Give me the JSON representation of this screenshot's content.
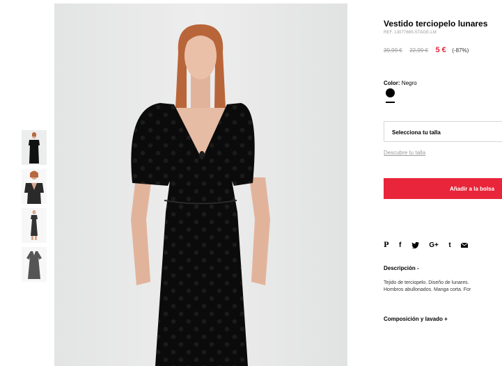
{
  "product": {
    "title": "Vestido terciopelo lunares",
    "ref": "REF. 13077665-STAGE-LM",
    "price_old_1": "39,99 €",
    "price_old_2": "22,99 €",
    "price_now": "5 €",
    "discount": "(-87%)"
  },
  "color": {
    "label": "Color:",
    "value": "Negro",
    "swatch_hex": "#000000"
  },
  "size": {
    "placeholder": "Selecciona tu talla",
    "guide_link": "Descubre tu talla"
  },
  "cart": {
    "add_label": "Añadir a la bolsa",
    "accent": "#e8253a"
  },
  "share": {
    "icons": [
      "pinterest-icon",
      "facebook-icon",
      "twitter-icon",
      "google-plus-icon",
      "tumblr-icon",
      "email-icon"
    ],
    "pinterest_glyph": "P",
    "facebook_glyph": "f",
    "googleplus_glyph": "G+",
    "tumblr_glyph": "t"
  },
  "description": {
    "heading": "Descripción -",
    "line1": "Tejido de terciopelo. Diseño de lunares.",
    "line2": "Hombros abullonados. Manga corta. For"
  },
  "composition": {
    "heading": "Composición y lavado +"
  },
  "gallery": {
    "thumbnails": [
      "front-view",
      "detail-view",
      "full-length-view",
      "flat-view"
    ]
  }
}
